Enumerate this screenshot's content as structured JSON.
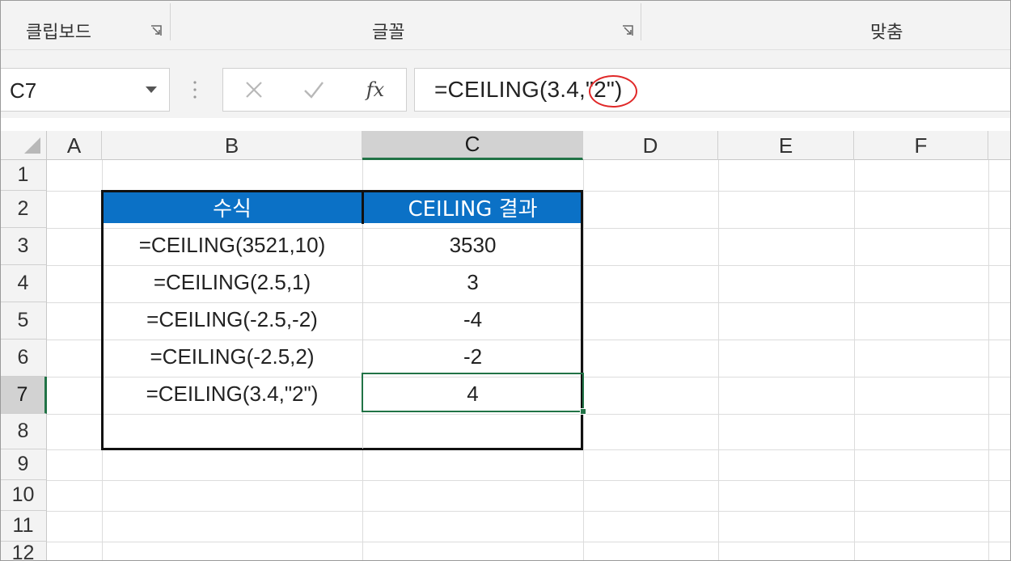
{
  "ribbon": {
    "groups": [
      {
        "label": "클립보드"
      },
      {
        "label": "글꼴"
      },
      {
        "label": "맞춤"
      }
    ]
  },
  "formula_bar": {
    "name_box": "C7",
    "cancel_icon": "x-icon",
    "enter_icon": "check-icon",
    "function_label": "fx",
    "formula": "=CEILING(3.4,\"2\")"
  },
  "columns": [
    "A",
    "B",
    "C",
    "D",
    "E",
    "F"
  ],
  "rows": [
    "1",
    "2",
    "3",
    "4",
    "5",
    "6",
    "7",
    "8",
    "9",
    "10",
    "11",
    "12"
  ],
  "selected_cell": {
    "column": "C",
    "row": "7"
  },
  "table": {
    "headers": [
      "수식",
      "CEILING 결과"
    ],
    "rows": [
      {
        "formula": "=CEILING(3521,10)",
        "result": "3530"
      },
      {
        "formula": "=CEILING(2.5,1)",
        "result": "3"
      },
      {
        "formula": "=CEILING(-2.5,-2)",
        "result": "-4"
      },
      {
        "formula": "=CEILING(-2.5,2)",
        "result": "-2"
      },
      {
        "formula": "=CEILING(3.4,\"2\")",
        "result": "4"
      }
    ]
  },
  "colors": {
    "header_blue": "#0b71c6",
    "selection_green": "#217346",
    "annotation_red": "#e02828"
  }
}
